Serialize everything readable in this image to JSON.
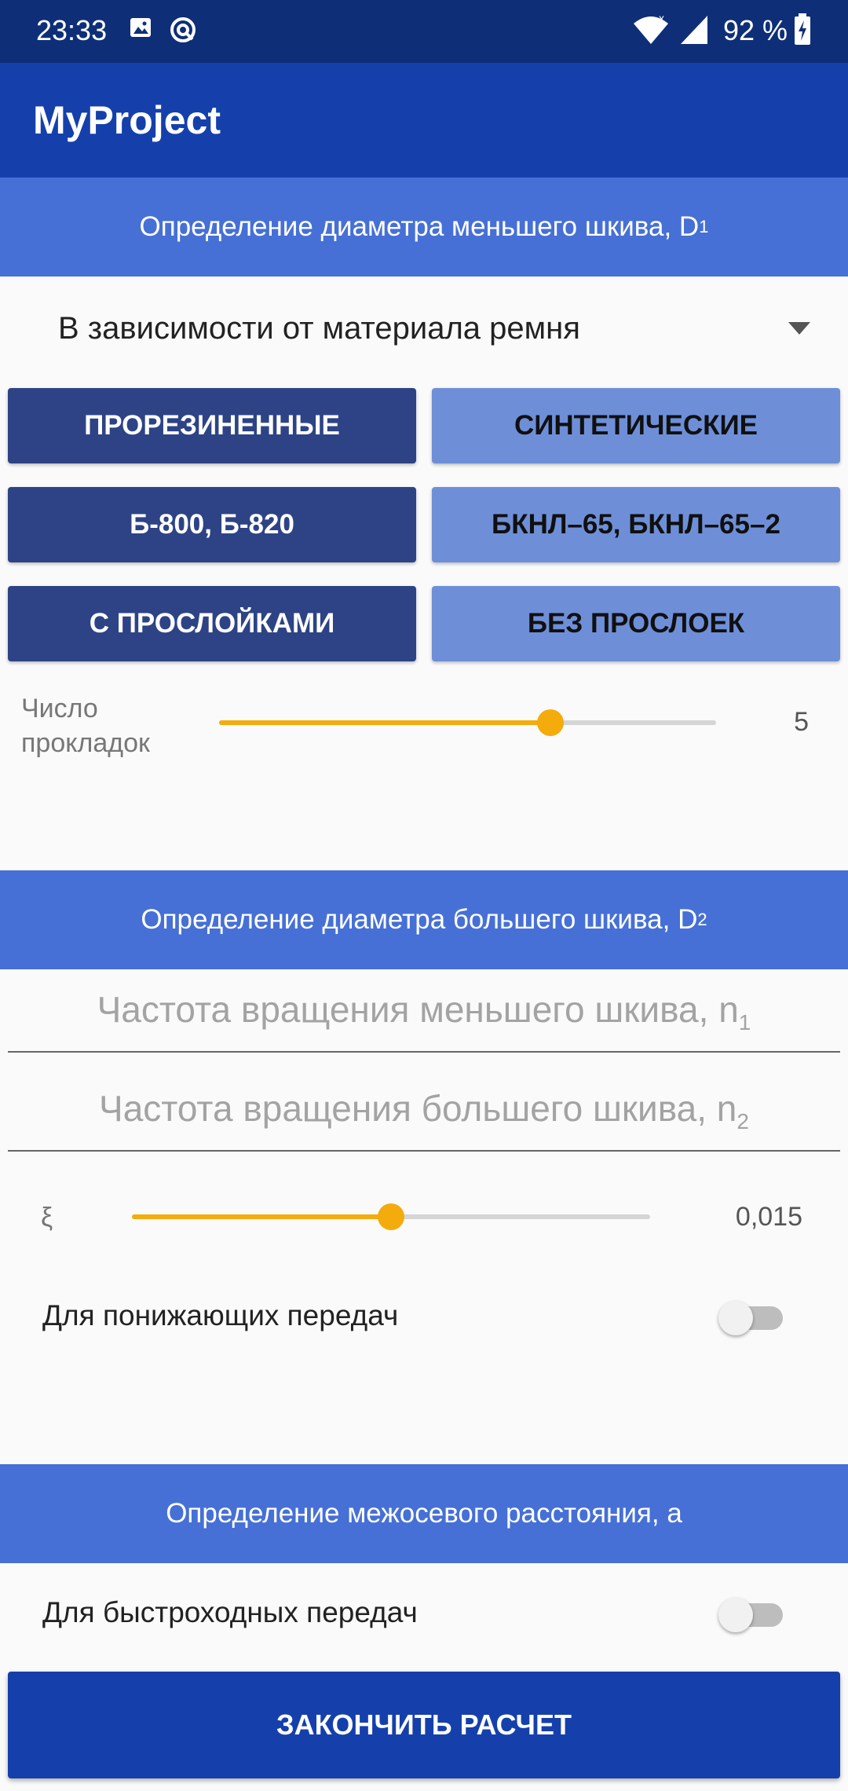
{
  "status_bar": {
    "time": "23:33",
    "battery": "92 %",
    "icons": [
      "image-icon",
      "sync-icon",
      "wifi-icon",
      "signal-icon",
      "battery-icon"
    ]
  },
  "app_bar": {
    "title": "MyProject"
  },
  "section1": {
    "header": "Определение диаметра меньшего шкива, D",
    "header_sub": "1",
    "dropdown_value": "В зависимости от материала ремня",
    "buttons": [
      {
        "label": "ПРОРЕЗИНЕННЫЕ",
        "style": "dark"
      },
      {
        "label": "СИНТЕТИЧЕСКИЕ",
        "style": "light"
      },
      {
        "label": "Б-800, Б-820",
        "style": "dark"
      },
      {
        "label": "БКНЛ–65, БКНЛ–65–2",
        "style": "light"
      },
      {
        "label": "С ПРОСЛОЙКАМИ",
        "style": "dark"
      },
      {
        "label": "БЕЗ ПРОСЛОЕК",
        "style": "light"
      }
    ],
    "slider": {
      "label_line1": "Число",
      "label_line2": "прокладок",
      "value": "5",
      "fraction": 0.666
    }
  },
  "section2": {
    "header": "Определение диаметра большего шкива, D",
    "header_sub": "2",
    "field1_placeholder": "Частота вращения меньшего шкива, n",
    "field1_sub": "1",
    "field2_placeholder": "Частота вращения большего шкива, n",
    "field2_sub": "2",
    "slider": {
      "label": "ξ",
      "value": "0,015",
      "fraction": 0.5
    },
    "switch_label": "Для понижающих передач",
    "switch_on": false
  },
  "section3": {
    "header": "Определение межосевого расстояния, a",
    "switch_label": "Для быстроходных передач",
    "switch_on": false
  },
  "finish_button": "ЗАКОНЧИТЬ РАСЧЕТ",
  "colors": {
    "status_bar": "#0e2f78",
    "app_bar": "#1540ac",
    "section_header": "#4670d6",
    "button_dark": "#2d4385",
    "button_light": "#6e8fd8",
    "slider_accent": "#f4ab0c"
  }
}
